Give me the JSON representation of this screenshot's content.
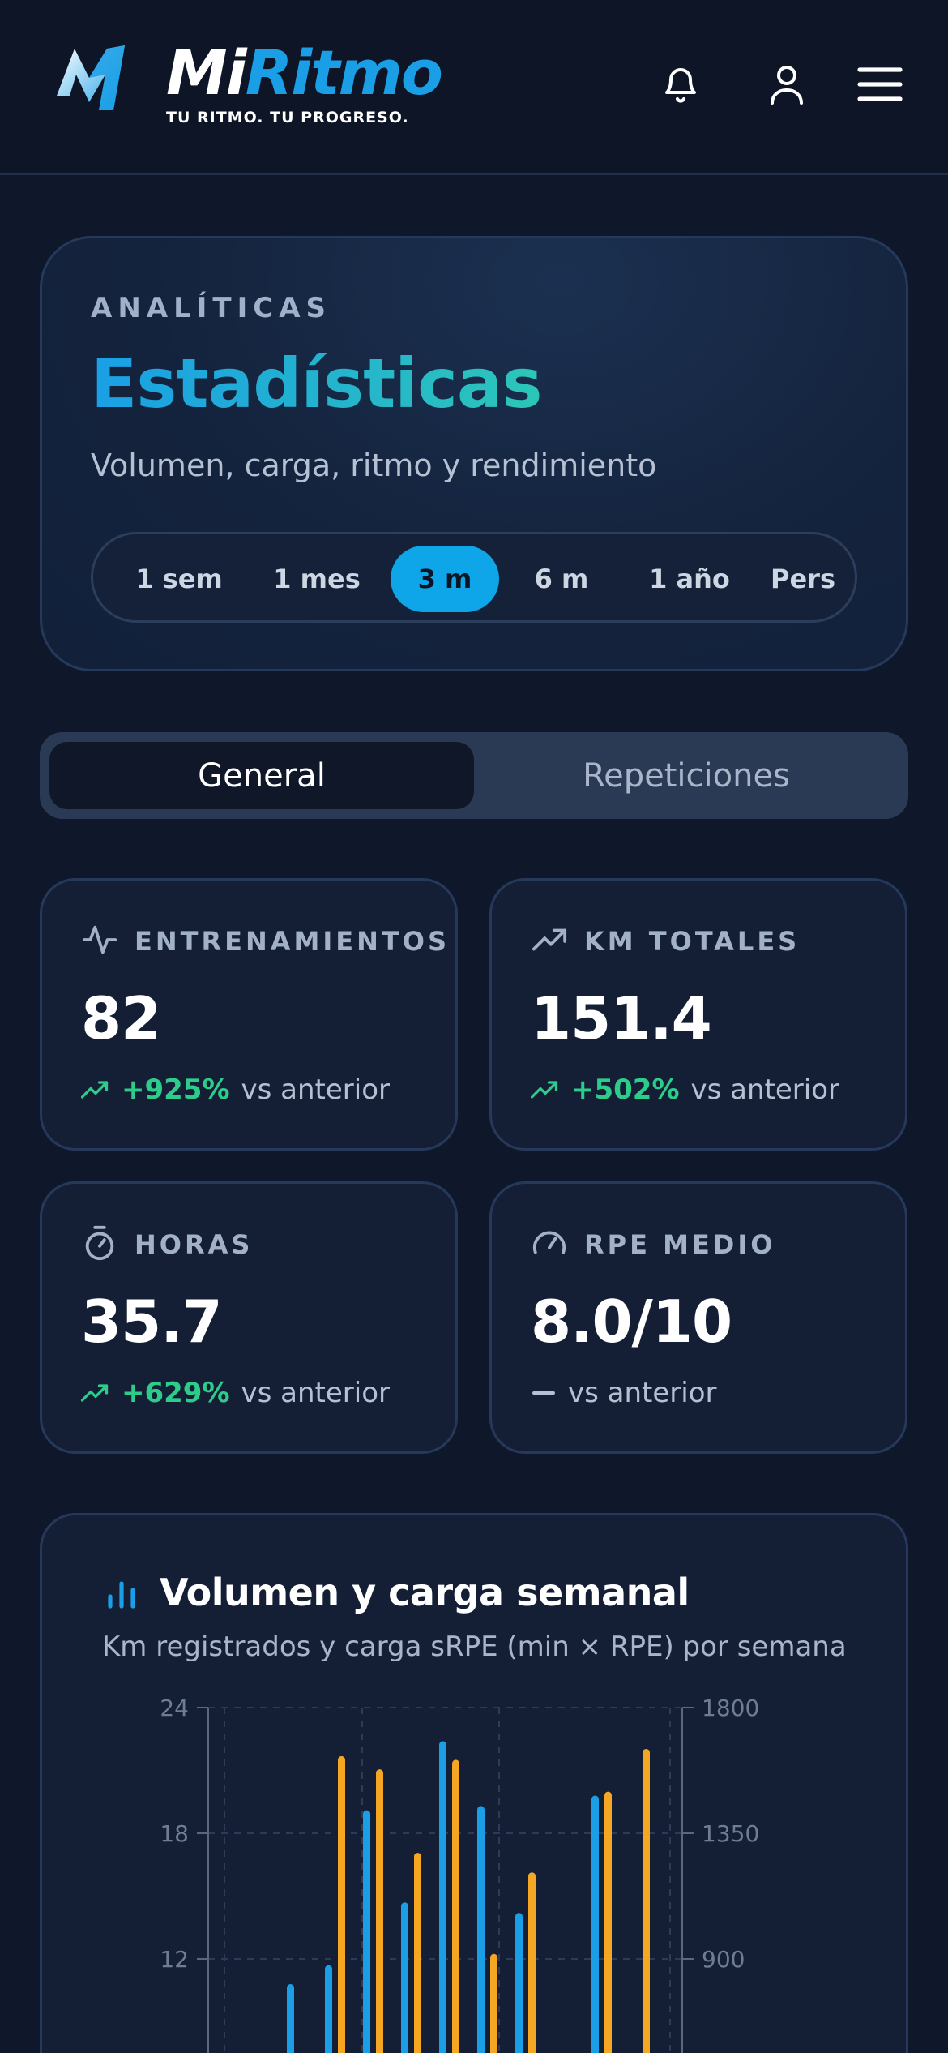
{
  "header": {
    "brand_mi": "Mi",
    "brand_ritmo": "Ritmo",
    "tagline": "TU RITMO. TU PROGRESO.",
    "icons": [
      "bell-icon",
      "user-icon",
      "menu-icon"
    ]
  },
  "hero": {
    "eyebrow": "ANALÍTICAS",
    "title": "Estadísticas",
    "subtitle": "Volumen, carga, ritmo y rendimiento",
    "ranges": [
      "1 sem",
      "1 mes",
      "3 m",
      "6 m",
      "1 año",
      "Pers"
    ],
    "selected_range": "3 m"
  },
  "tabs": {
    "general": "General",
    "reps": "Repeticiones",
    "active": "General"
  },
  "stats": [
    {
      "icon": "activity-icon",
      "label": "ENTRENAMIENTOS",
      "value": "82",
      "change": "+925%",
      "suffix": "vs anterior",
      "trend": "up"
    },
    {
      "icon": "trending-up-icon",
      "label": "KM TOTALES",
      "value": "151.4",
      "change": "+502%",
      "suffix": "vs anterior",
      "trend": "up"
    },
    {
      "icon": "timer-icon",
      "label": "HORAS",
      "value": "35.7",
      "change": "+629%",
      "suffix": "vs anterior",
      "trend": "up"
    },
    {
      "icon": "gauge-icon",
      "label": "RPE MEDIO",
      "value": "8.0/10",
      "change": "",
      "suffix": "vs anterior",
      "trend": "flat"
    }
  ],
  "chart": {
    "title": "Volumen y carga semanal",
    "subtitle": "Km registrados y carga sRPE (min × RPE) por semana"
  },
  "colors": {
    "accent": "#0ea5e9",
    "km": "#1a9fe6",
    "load": "#f5a623",
    "positive": "#2ecc8a"
  },
  "chart_data": {
    "type": "bar",
    "title": "Volumen y carga semanal",
    "left_axis": {
      "ticks": [
        12,
        18,
        24
      ],
      "ylim": [
        0,
        24
      ]
    },
    "right_axis": {
      "ticks": [
        900,
        1350,
        1800
      ],
      "ylim": [
        0,
        1800
      ]
    },
    "series": [
      {
        "values": [
          0,
          10.8,
          11.7,
          19.1,
          14.7,
          22.4,
          19.3,
          14.2,
          0,
          19.8,
          0
        ]
      },
      {
        "values": [
          0,
          0,
          1626,
          1579,
          1280,
          1613,
          918,
          1210,
          0,
          1499,
          1652
        ]
      }
    ]
  }
}
